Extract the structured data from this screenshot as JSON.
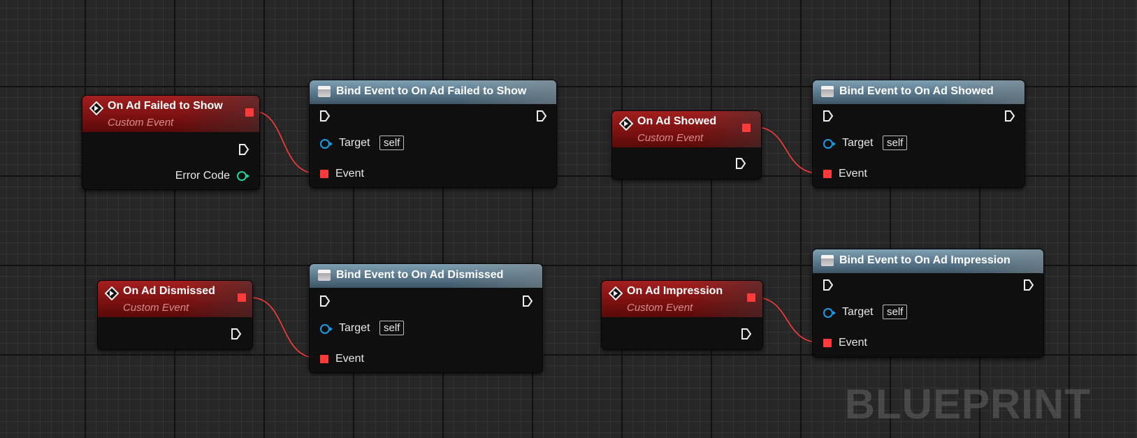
{
  "watermark": "BLUEPRINT",
  "colors": {
    "event_header": "#a31f1f",
    "function_header": "#58768a",
    "delegate_pin": "#ff3a3a",
    "object_pin": "#1a9ce6",
    "int_pin": "#1fd6a0",
    "wire": "#ff3a3a"
  },
  "events": [
    {
      "title": "On Ad Failed to Show",
      "subtitle": "Custom Event",
      "output_label": "Error Code"
    },
    {
      "title": "On Ad Showed",
      "subtitle": "Custom Event"
    },
    {
      "title": "On Ad Dismissed",
      "subtitle": "Custom Event"
    },
    {
      "title": "On Ad Impression",
      "subtitle": "Custom Event"
    }
  ],
  "binds": [
    {
      "title": "Bind Event to On Ad Failed to Show",
      "target_label": "Target",
      "target_value": "self",
      "event_label": "Event"
    },
    {
      "title": "Bind Event to On Ad Showed",
      "target_label": "Target",
      "target_value": "self",
      "event_label": "Event"
    },
    {
      "title": "Bind Event to On Ad Dismissed",
      "target_label": "Target",
      "target_value": "self",
      "event_label": "Event"
    },
    {
      "title": "Bind Event to On Ad Impression",
      "target_label": "Target",
      "target_value": "self",
      "event_label": "Event"
    }
  ]
}
